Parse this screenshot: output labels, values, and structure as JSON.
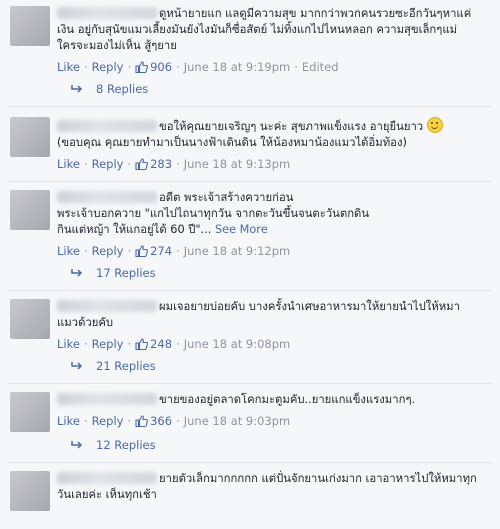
{
  "ui": {
    "like": "Like",
    "reply": "Reply",
    "dot": "·",
    "see_more": "See More"
  },
  "comments": [
    {
      "text": "ดูหน้ายายแก แลดูมีความสุข มากกว่าพวกคนรวยซะอีกวันๆหาแค่\nเงิน อยู่กับสุนัขแมวเลี้ยงมันยังไงมันก็ซื่อสัตย์ ไม่ทิ้งแกไปไหนหลอก ความสุขเล็กๆแม่\nใครจะมองไม่เห็น สู้ๆยาย",
      "likes": "906",
      "date": "June 18 at 9:19pm",
      "edited": "Edited",
      "replies": "8 Replies"
    },
    {
      "text": "ขอให้คุณยายเจริญๆ นะค่ะ สุขภาพแข็งแรง อายุยืนยาว",
      "text2": "(ขอบคุณ คุณยายทำมาเป็นนางฟ้าเดินดิน ให้น้องหมาน้องแมวได้อิ่มท้อง)",
      "likes": "283",
      "date": "June 18 at 9:13pm"
    },
    {
      "text": "อดีต พระเจ้าสร้างควายก่อน\nพระเจ้าบอกควาย \"แกไปไถนาทุกวัน จากตะวันขึ้นจนตะวันตกดิน\nกินแต่หญ้า ให้แกอยู่ได้ 60 ปี\"...",
      "likes": "274",
      "date": "June 18 at 9:12pm",
      "replies": "17 Replies"
    },
    {
      "text": "ผมเจอยายบ่อยคับ บางครั้งนำเศษอาหารมาให้ยายนำไปให้หมา\nแมวด้วยคับ",
      "likes": "248",
      "date": "June 18 at 9:08pm",
      "replies": "21 Replies"
    },
    {
      "text": "ขายของอยู่ตลาดโคกมะตูมคับ..ยายแกแข็งแรงมากๆ.",
      "likes": "366",
      "date": "June 18 at 9:03pm",
      "replies": "12 Replies"
    },
    {
      "text": "ยายตัวเล็กมากกกกก แต่ปั่นจักยานเก่งมาก เอาอาหารไปให้หมาทุก\nวันเลยค่ะ เห็นทุกเช้า"
    }
  ]
}
